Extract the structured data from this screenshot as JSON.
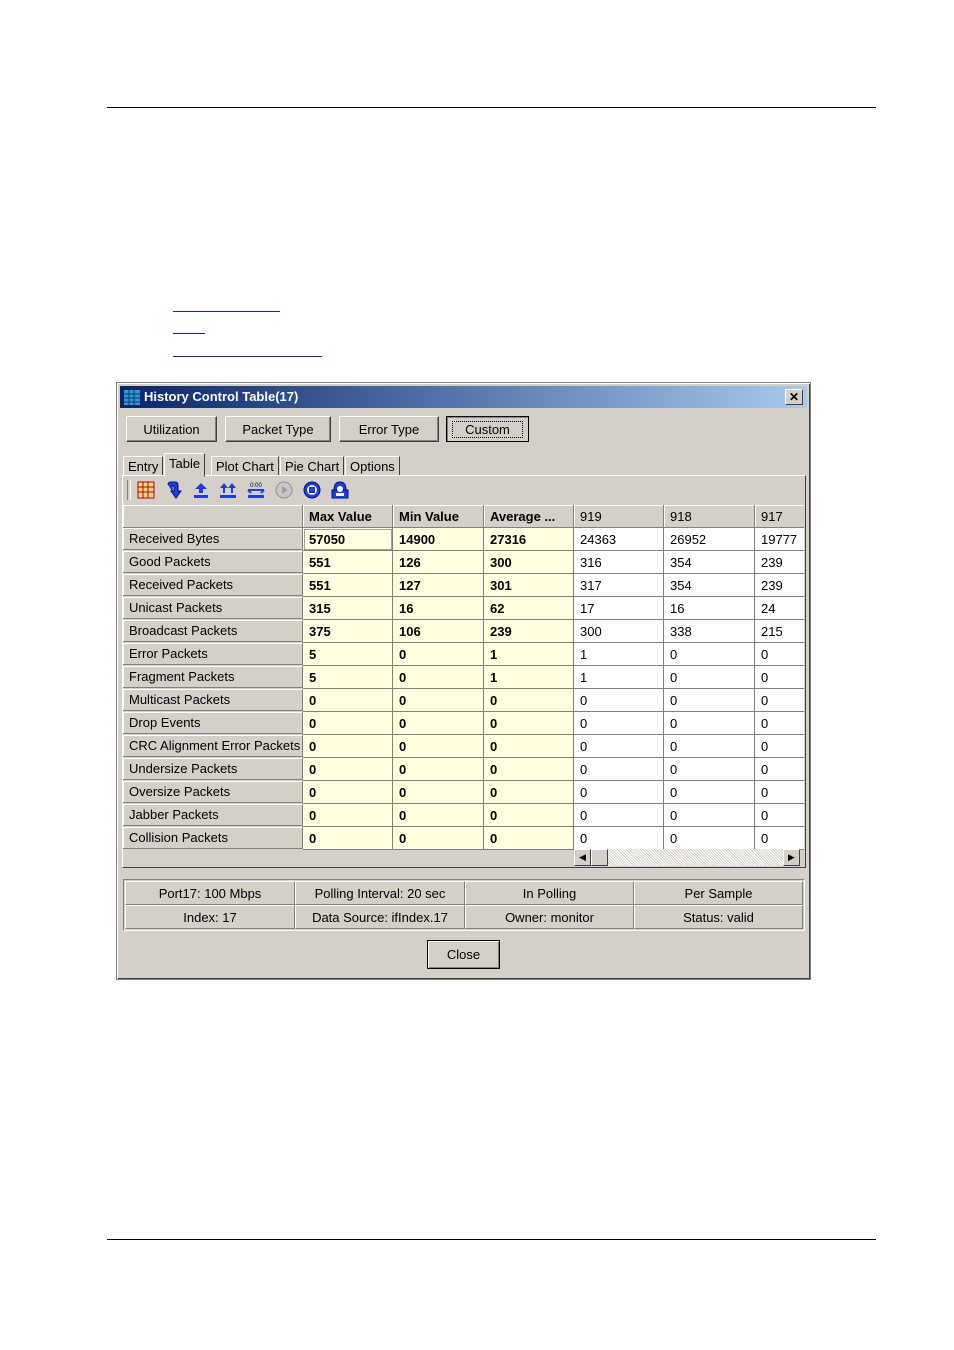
{
  "window": {
    "title": "History Control Table(17)",
    "close_glyph": "✕"
  },
  "view_buttons": [
    "Utilization",
    "Packet Type",
    "Error Type",
    "Custom"
  ],
  "selected_view": "Custom",
  "tabs": [
    "Entry",
    "Table",
    "Plot Chart",
    "Pie Chart",
    "Options"
  ],
  "active_tab": "Table",
  "toolbar_icons": [
    "table-grid-icon",
    "refresh-down-icon",
    "move-up-icon",
    "move-both-icon",
    "interval-icon",
    "play-icon",
    "stop-icon",
    "save-icon"
  ],
  "table": {
    "headers": [
      "",
      "Max Value",
      "Min Value",
      "Average ...",
      "919",
      "918",
      "917"
    ],
    "rows": [
      {
        "label": "Received Bytes",
        "max": "57050",
        "min": "14900",
        "avg": "27316",
        "samples": [
          "24363",
          "26952",
          "19777"
        ]
      },
      {
        "label": "Good Packets",
        "max": "551",
        "min": "126",
        "avg": "300",
        "samples": [
          "316",
          "354",
          "239"
        ]
      },
      {
        "label": "Received Packets",
        "max": "551",
        "min": "127",
        "avg": "301",
        "samples": [
          "317",
          "354",
          "239"
        ]
      },
      {
        "label": "Unicast Packets",
        "max": "315",
        "min": "16",
        "avg": "62",
        "samples": [
          "17",
          "16",
          "24"
        ]
      },
      {
        "label": "Broadcast Packets",
        "max": "375",
        "min": "106",
        "avg": "239",
        "samples": [
          "300",
          "338",
          "215"
        ]
      },
      {
        "label": "Error Packets",
        "max": "5",
        "min": "0",
        "avg": "1",
        "samples": [
          "1",
          "0",
          "0"
        ]
      },
      {
        "label": "Fragment Packets",
        "max": "5",
        "min": "0",
        "avg": "1",
        "samples": [
          "1",
          "0",
          "0"
        ]
      },
      {
        "label": "Multicast Packets",
        "max": "0",
        "min": "0",
        "avg": "0",
        "samples": [
          "0",
          "0",
          "0"
        ]
      },
      {
        "label": "Drop Events",
        "max": "0",
        "min": "0",
        "avg": "0",
        "samples": [
          "0",
          "0",
          "0"
        ]
      },
      {
        "label": "CRC Alignment Error Packets",
        "max": "0",
        "min": "0",
        "avg": "0",
        "samples": [
          "0",
          "0",
          "0"
        ]
      },
      {
        "label": "Undersize Packets",
        "max": "0",
        "min": "0",
        "avg": "0",
        "samples": [
          "0",
          "0",
          "0"
        ]
      },
      {
        "label": "Oversize Packets",
        "max": "0",
        "min": "0",
        "avg": "0",
        "samples": [
          "0",
          "0",
          "0"
        ]
      },
      {
        "label": "Jabber Packets",
        "max": "0",
        "min": "0",
        "avg": "0",
        "samples": [
          "0",
          "0",
          "0"
        ]
      },
      {
        "label": "Collision Packets",
        "max": "0",
        "min": "0",
        "avg": "0",
        "samples": [
          "0",
          "0",
          "0"
        ]
      }
    ]
  },
  "status": {
    "row1": [
      "Port17: 100 Mbps",
      "Polling Interval: 20 sec",
      "In Polling",
      "Per Sample"
    ],
    "row2": [
      "Index: 17",
      "Data Source: ifIndex.17",
      "Owner: monitor",
      "Status: valid"
    ]
  },
  "close_button": "Close",
  "colors": {
    "title_start": "#0a246a",
    "title_end": "#a6caf0",
    "stat_cell_bg": "#ffffe0",
    "window_bg": "#d4d0c8",
    "link": "#1a1ad6"
  }
}
